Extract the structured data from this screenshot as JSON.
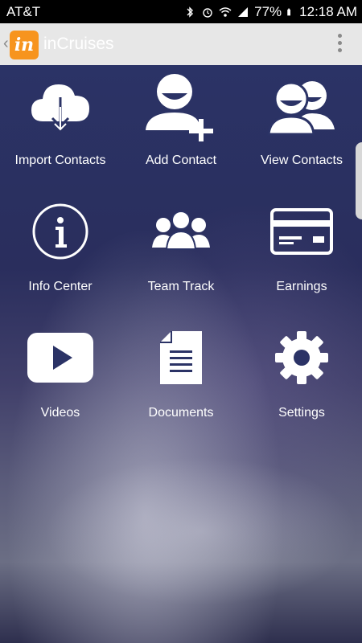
{
  "status_bar": {
    "carrier": "AT&T",
    "battery": "77%",
    "time": "12:18 AM"
  },
  "app_bar": {
    "title": "inCruises",
    "logo_text": "in"
  },
  "menu": [
    {
      "label": "Import Contacts",
      "icon": "cloud-download-icon"
    },
    {
      "label": "Add Contact",
      "icon": "add-person-icon"
    },
    {
      "label": "View Contacts",
      "icon": "people-icon"
    },
    {
      "label": "Info Center",
      "icon": "info-icon"
    },
    {
      "label": "Team Track",
      "icon": "team-icon"
    },
    {
      "label": "Earnings",
      "icon": "credit-card-icon"
    },
    {
      "label": "Videos",
      "icon": "play-icon"
    },
    {
      "label": "Documents",
      "icon": "document-icon"
    },
    {
      "label": "Settings",
      "icon": "gear-icon"
    }
  ],
  "colors": {
    "brand_orange": "#f7941e",
    "appbar_bg": "#e7e7e7",
    "content_bg_top": "#2b3366"
  }
}
